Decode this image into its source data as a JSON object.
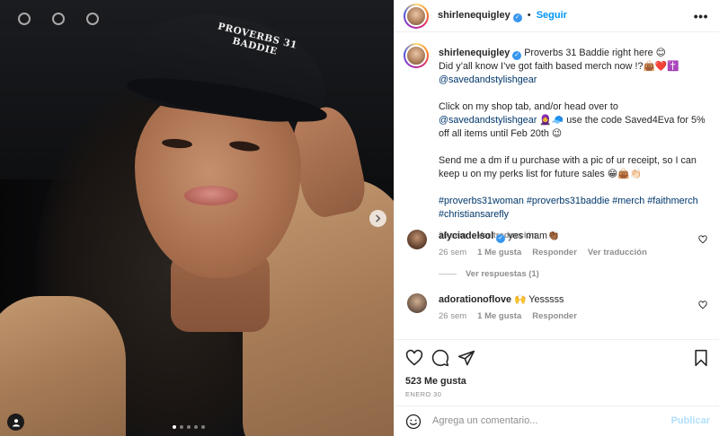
{
  "post": {
    "username": "shirlenequigley",
    "follow_label": "Seguir",
    "more_icon": "more-horizontal-icon",
    "image": {
      "cap_text_line1": "PROVERBS 31",
      "cap_text_line2": "BADDIE",
      "carousel_count": 5,
      "carousel_active": 0
    },
    "caption": {
      "line1": "Proverbs 31 Baddie right here 😊",
      "line2": "Did y’all know I’ve got faith based merch now !?👜❤️✝️",
      "mention1": "@savedandstylishgear",
      "para2_pre": "Click on my shop tab, and/or head over to",
      "mention2": "@savedandstylishgear",
      "para2_post": "🧕🧢 use the code Saved4Eva for 5% off all items until Feb 20th 😉",
      "para3": "Send me a dm if u purchase with a pic of ur receipt, so I can keep u on my perks list for future sales 😁👜👏🏻",
      "hashtags_line1": "#proverbs31woman #proverbs31baddie #merch #faithmerch",
      "hashtags_line2": "#christiansarefly",
      "time": "26 sem",
      "translate": "Ver traducción"
    },
    "comments": [
      {
        "username": "alyciadelsol",
        "verified": true,
        "text": "yes mam👏🏾",
        "time": "26 sem",
        "likes": "1 Me gusta",
        "reply": "Responder",
        "translate": "Ver traducción",
        "view_replies": "Ver respuestas (1)"
      },
      {
        "username": "adorationoflove",
        "verified": false,
        "text": "🙌 Yesssss",
        "time": "26 sem",
        "likes": "1 Me gusta",
        "reply": "Responder"
      }
    ],
    "likes_label": "523 Me gusta",
    "date": "ENERO 30",
    "add_comment_placeholder": "Agrega un comentario...",
    "publish_label": "Publicar"
  },
  "colors": {
    "link_blue": "#0095f6",
    "mention": "#00376b",
    "muted": "#8e8e8e",
    "verified": "#3897f0"
  }
}
